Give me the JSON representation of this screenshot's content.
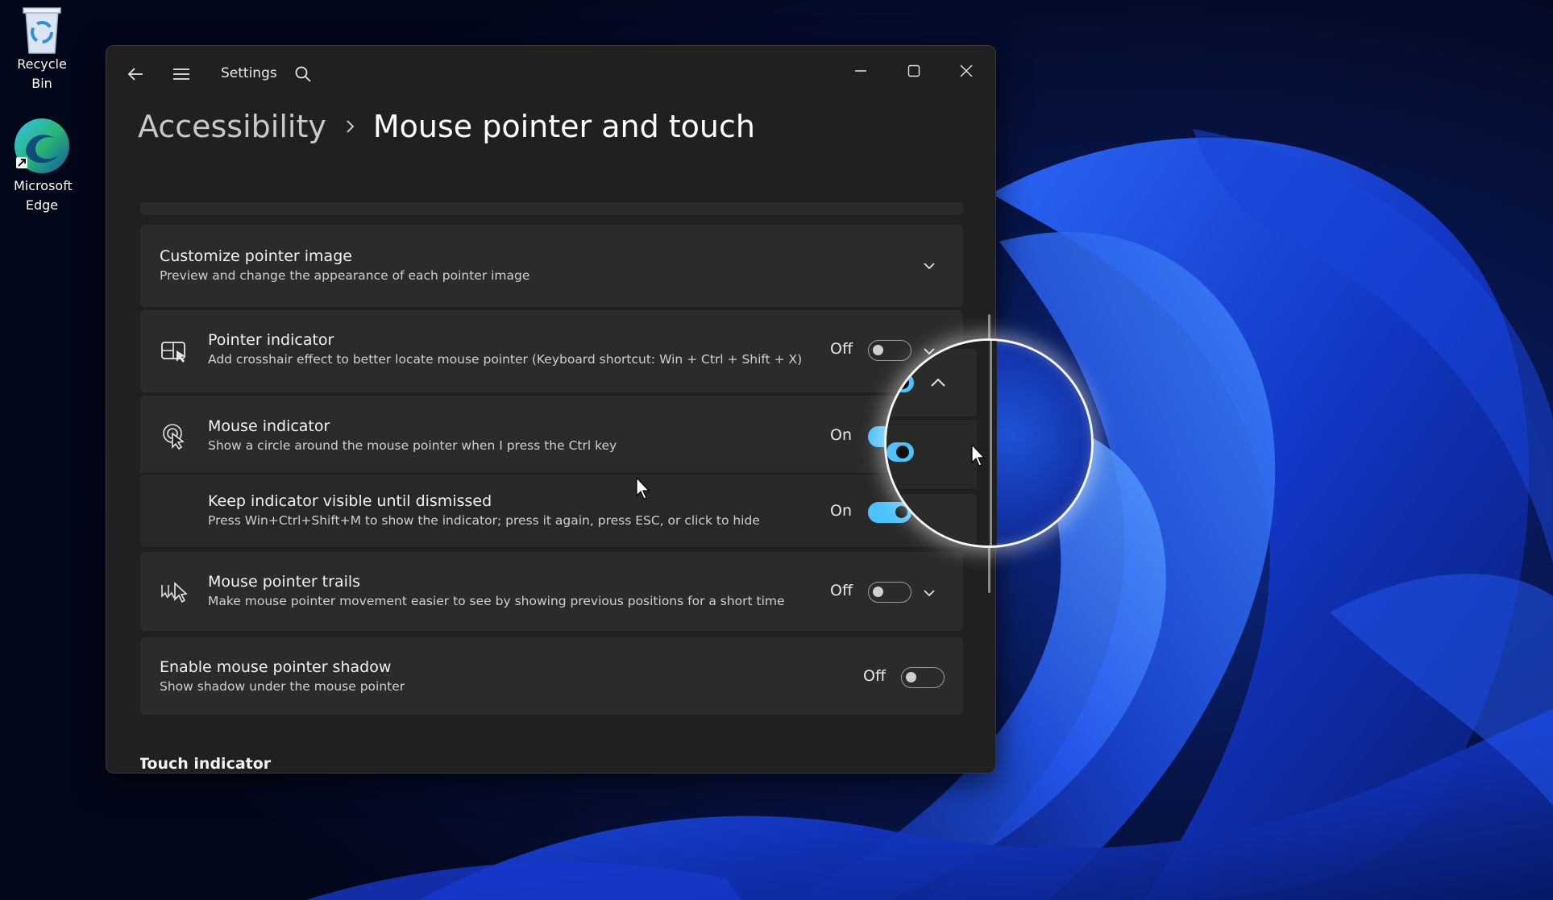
{
  "desktop": {
    "icons": [
      {
        "label": "Recycle Bin",
        "icon": "recycle-bin-icon"
      },
      {
        "label": "Microsoft Edge",
        "icon": "edge-icon"
      }
    ]
  },
  "window": {
    "app_title": "Settings",
    "breadcrumb": {
      "parent": "Accessibility",
      "current": "Mouse pointer and touch"
    },
    "controls": {
      "back": "back-arrow-icon",
      "menu": "hamburger-icon",
      "search": "search-icon",
      "minimize": "minimize-icon",
      "maximize": "maximize-icon",
      "close": "close-icon"
    }
  },
  "settings": {
    "customize_pointer": {
      "title": "Customize pointer image",
      "description": "Preview and change the appearance of each pointer image"
    },
    "pointer_indicator": {
      "title": "Pointer indicator",
      "description": "Add crosshair effect to better locate mouse pointer (Keyboard shortcut: Win + Ctrl + Shift + X)",
      "state": "Off",
      "on": false
    },
    "mouse_indicator": {
      "title": "Mouse indicator",
      "description": "Show a circle around the mouse pointer when I press the Ctrl key",
      "state": "On",
      "on": true
    },
    "keep_visible": {
      "title": "Keep indicator visible until dismissed",
      "description": "Press Win+Ctrl+Shift+M to show the indicator; press it again, press ESC, or click to hide",
      "state": "On",
      "on": true
    },
    "pointer_trails": {
      "title": "Mouse pointer trails",
      "description": "Make mouse pointer movement easier to see by showing previous positions for a short time",
      "state": "Off",
      "on": false
    },
    "pointer_shadow": {
      "title": "Enable mouse pointer shadow",
      "description": "Show shadow under the mouse pointer",
      "state": "Off",
      "on": false
    },
    "touch_section": {
      "title": "Touch indicator"
    }
  },
  "colors": {
    "accent": "#4cc2ff",
    "window_bg": "#202020",
    "card_bg": "#2b2b2b"
  }
}
